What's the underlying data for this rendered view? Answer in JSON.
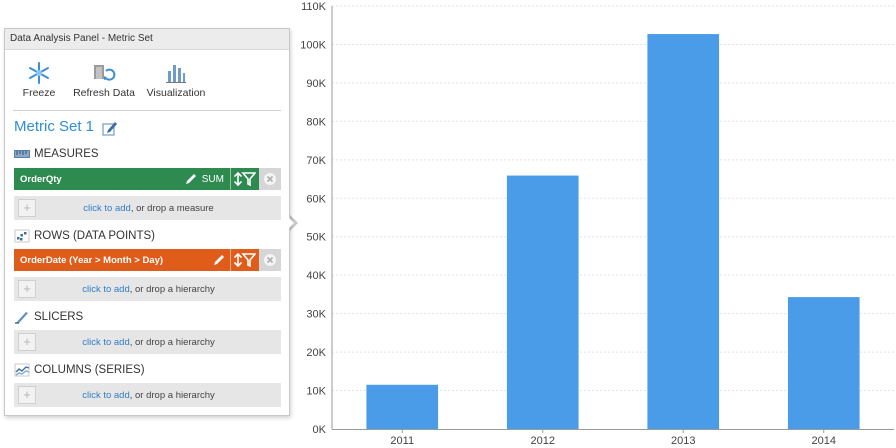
{
  "panel": {
    "title": "Data Analysis Panel - Metric Set",
    "toolbar": [
      {
        "label": "Freeze",
        "icon": "snowflake-icon"
      },
      {
        "label": "Refresh Data",
        "icon": "refresh-data-icon"
      },
      {
        "label": "Visualization",
        "icon": "bar-chart-icon"
      }
    ],
    "metric_set_name": "Metric Set 1",
    "sections": {
      "measures": {
        "header": "MEASURES",
        "field": {
          "name": "OrderQty",
          "aggregation": "SUM",
          "color": "#2e8b4f"
        },
        "drop": {
          "link": "click to add",
          "rest": ", or drop a measure"
        }
      },
      "rows": {
        "header": "ROWS (DATA POINTS)",
        "field": {
          "name": "OrderDate (Year > Month > Day)",
          "color": "#e05c1b"
        },
        "drop": {
          "link": "click to add",
          "rest": ", or drop a hierarchy"
        }
      },
      "slicers": {
        "header": "SLICERS",
        "drop": {
          "link": "click to add",
          "rest": ", or drop a hierarchy"
        }
      },
      "columns": {
        "header": "COLUMNS (SERIES)",
        "drop": {
          "link": "click to add",
          "rest": ", or drop a hierarchy"
        }
      }
    }
  },
  "chart_data": {
    "type": "bar",
    "categories": [
      "2011",
      "2012",
      "2013",
      "2014"
    ],
    "values": [
      11500,
      65900,
      102700,
      34300
    ],
    "ylim": [
      0,
      110000
    ],
    "yticks": [
      "0K",
      "10K",
      "20K",
      "30K",
      "40K",
      "50K",
      "60K",
      "70K",
      "80K",
      "90K",
      "100K",
      "110K"
    ],
    "bar_color": "#4a9be8",
    "grid": true,
    "legend": "none"
  }
}
